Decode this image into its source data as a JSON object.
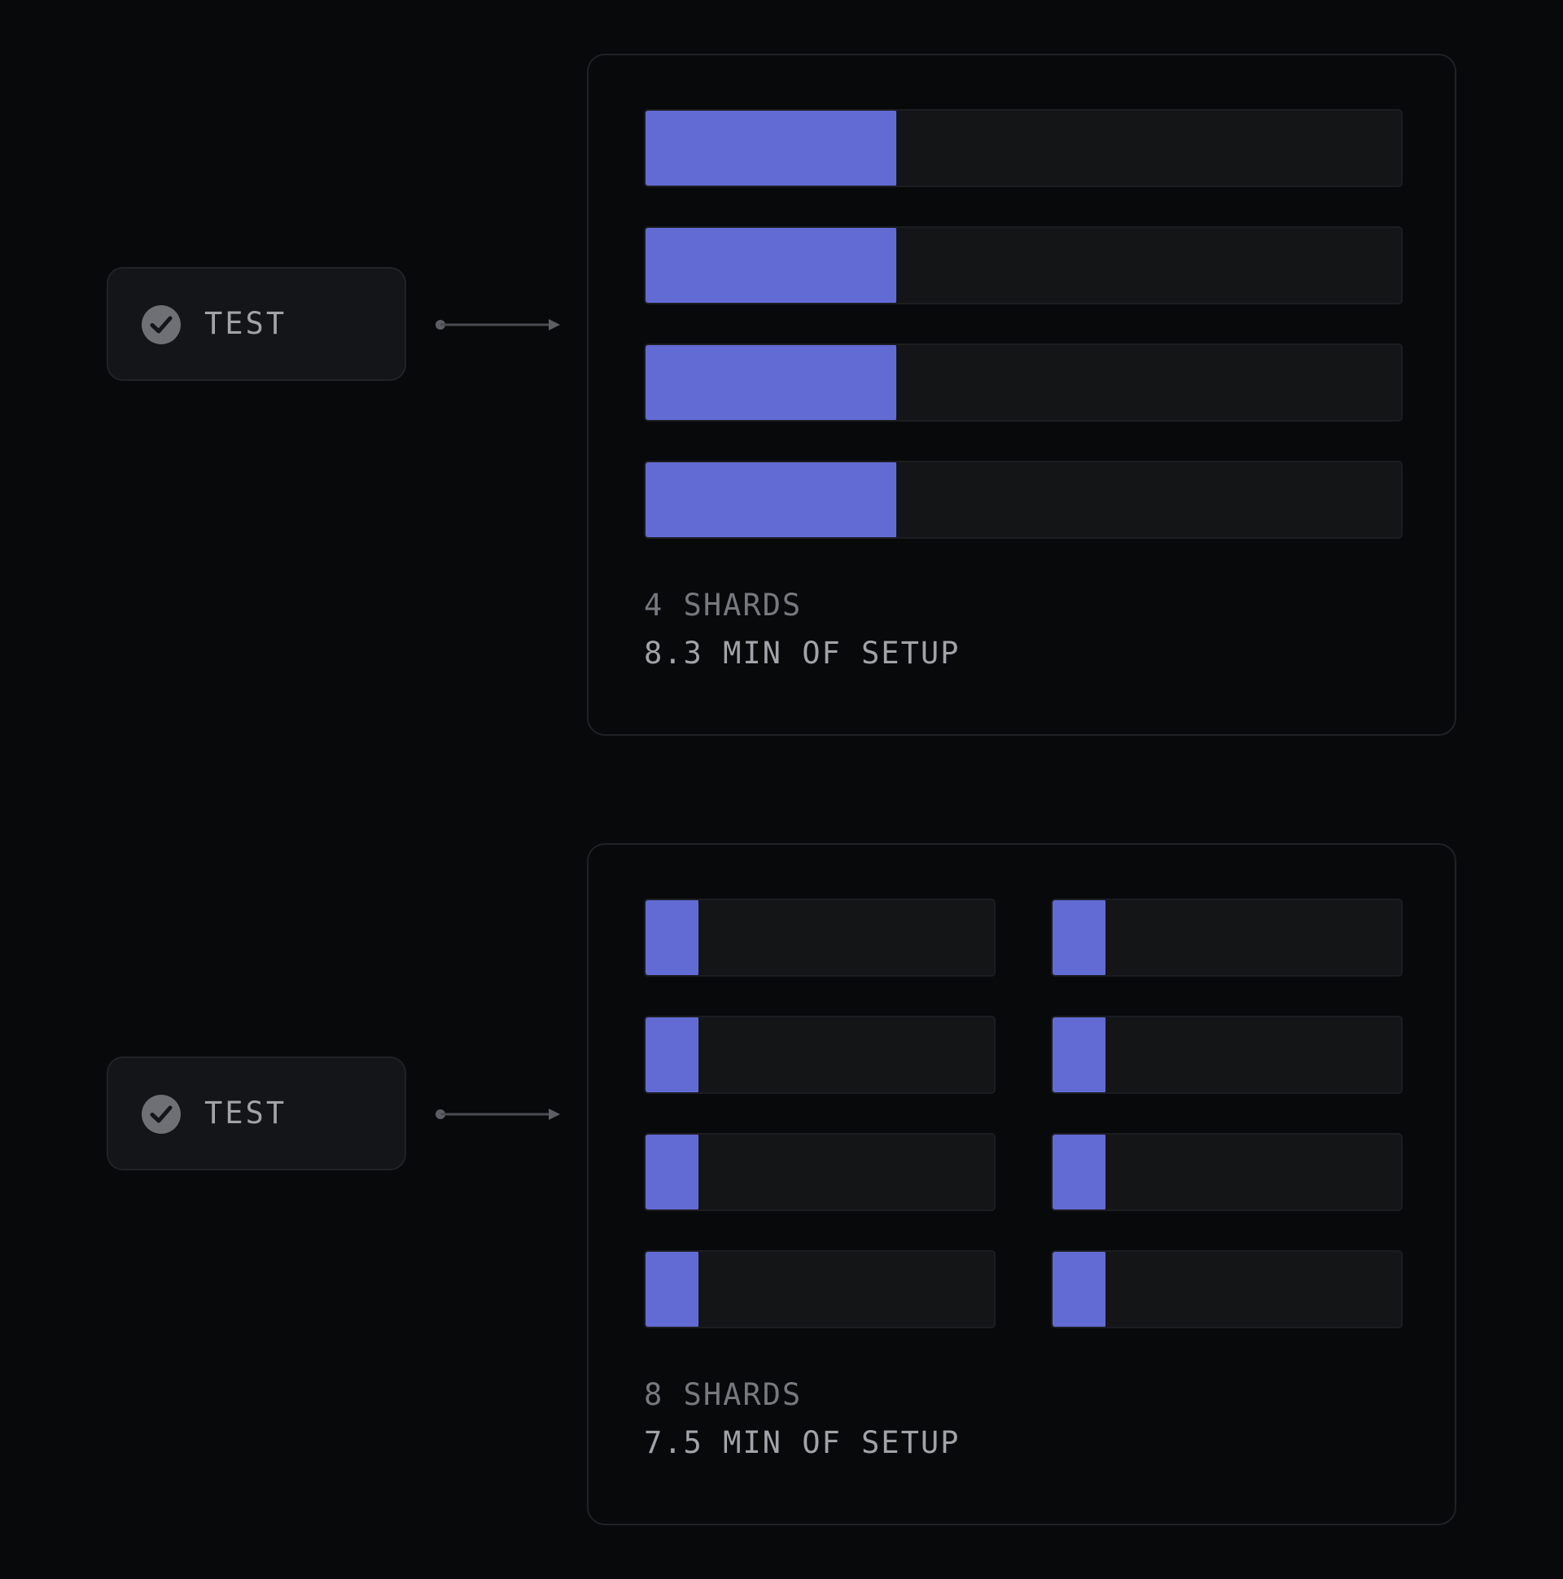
{
  "colors": {
    "background": "#08090b",
    "node_bg": "#141518",
    "bar_fill": "#626bd4",
    "track_bg": "#141517",
    "muted_text": "#77797f",
    "text": "#a1a3a8"
  },
  "sections": [
    {
      "node": {
        "label": "TEST",
        "icon": "check-circle-icon"
      },
      "panel": {
        "columns": 1,
        "shards_label": "4 SHARDS",
        "setup_label": "8.3 MIN OF SETUP",
        "bars": [
          0.33,
          0.33,
          0.33,
          0.33
        ]
      }
    },
    {
      "node": {
        "label": "TEST",
        "icon": "check-circle-icon"
      },
      "panel": {
        "columns": 2,
        "shards_label": "8 SHARDS",
        "setup_label": "7.5 MIN OF SETUP",
        "bars": [
          0.15,
          0.15,
          0.15,
          0.15,
          0.15,
          0.15,
          0.15,
          0.15
        ]
      }
    }
  ]
}
